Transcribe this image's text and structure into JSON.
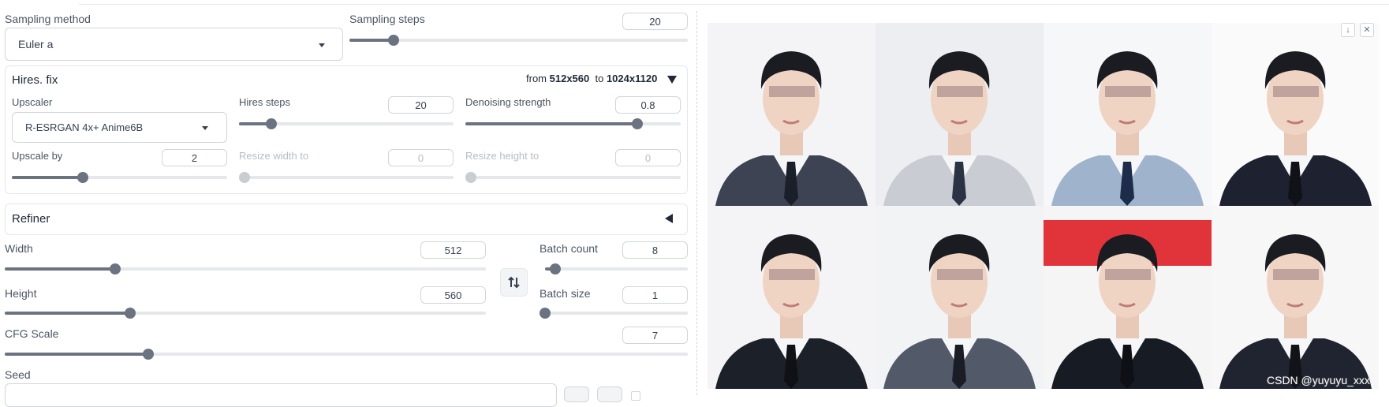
{
  "sampling": {
    "method_label": "Sampling method",
    "method_value": "Euler a",
    "steps_label": "Sampling steps",
    "steps_value": "20",
    "steps_fraction": 0.13
  },
  "hires": {
    "title": "Hires. fix",
    "summary_from": "from",
    "summary_from_size": "512x560",
    "summary_to": "to",
    "summary_to_size": "1024x1120",
    "upscaler_label": "Upscaler",
    "upscaler_value": "R-ESRGAN 4x+ Anime6B",
    "steps_label": "Hires steps",
    "steps_value": "20",
    "steps_fraction": 0.15,
    "denoise_label": "Denoising strength",
    "denoise_value": "0.8",
    "denoise_fraction": 0.8,
    "upscale_by_label": "Upscale by",
    "upscale_by_value": "2",
    "upscale_by_fraction": 0.33,
    "resize_w_label": "Resize width to",
    "resize_w_value": "0",
    "resize_h_label": "Resize height to",
    "resize_h_value": "0"
  },
  "refiner": {
    "title": "Refiner"
  },
  "size": {
    "width_label": "Width",
    "width_value": "512",
    "width_fraction": 0.23,
    "height_label": "Height",
    "height_value": "560",
    "height_fraction": 0.26,
    "batch_count_label": "Batch count",
    "batch_count_value": "8",
    "batch_count_fraction": 0.07,
    "batch_size_label": "Batch size",
    "batch_size_value": "1",
    "batch_size_fraction": 0.0
  },
  "cfg": {
    "label": "CFG Scale",
    "value": "7",
    "fraction": 0.21
  },
  "seed": {
    "label": "Seed"
  },
  "gallery": {
    "watermark": "CSDN @yuyuyu_xxx",
    "images": [
      {
        "suit": "#3d4352",
        "bg": "#f4f4f6",
        "tie": "#1b1f2a"
      },
      {
        "suit": "#c9ccd2",
        "bg": "#eceef1",
        "tie": "#2a3244"
      },
      {
        "suit": "#9fb3cc",
        "bg": "#f6f7f9",
        "tie": "#1c2c4a"
      },
      {
        "suit": "#1e2230",
        "bg": "#fafafa",
        "tie": "#101218"
      },
      {
        "suit": "#1c2028",
        "bg": "#f4f4f6",
        "tie": "#0f1116"
      },
      {
        "suit": "#525a6a",
        "bg": "#f2f3f5",
        "tie": "#1a1d25"
      },
      {
        "suit": "#171b24",
        "bg": "#f5f5f5",
        "tie": "#0e1015",
        "band": "#e0343a"
      },
      {
        "suit": "#1f2430",
        "bg": "#f7f7f8",
        "tie": "#111319"
      }
    ]
  }
}
